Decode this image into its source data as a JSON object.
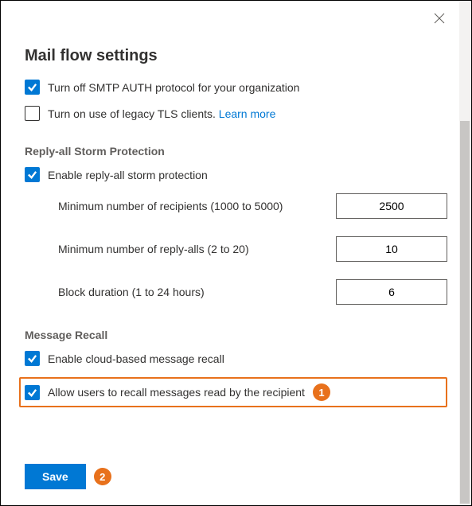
{
  "title": "Mail flow settings",
  "smtp_auth_label": "Turn off SMTP AUTH protocol for your organization",
  "legacy_tls_label": "Turn on use of legacy TLS clients. ",
  "learn_more": "Learn more",
  "storm": {
    "heading": "Reply-all Storm Protection",
    "enable_label": "Enable reply-all storm protection",
    "min_recipients_label": "Minimum number of recipients (1000 to 5000)",
    "min_recipients_value": "2500",
    "min_replyalls_label": "Minimum number of reply-alls (2 to 20)",
    "min_replyalls_value": "10",
    "block_duration_label": "Block duration (1 to 24 hours)",
    "block_duration_value": "6"
  },
  "recall": {
    "heading": "Message Recall",
    "enable_cloud_label": "Enable cloud-based message recall",
    "allow_read_label": "Allow users to recall messages read by the recipient"
  },
  "callout_1": "1",
  "callout_2": "2",
  "save_label": "Save"
}
